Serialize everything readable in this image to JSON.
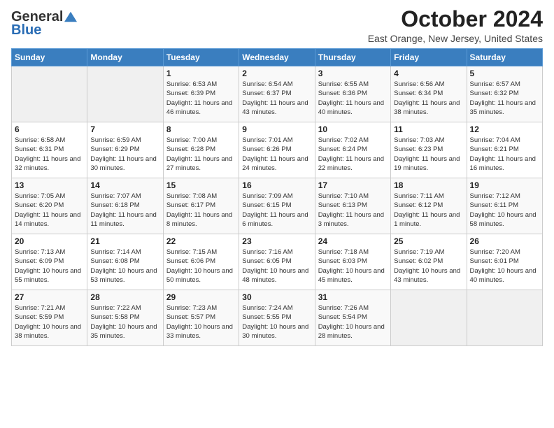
{
  "logo": {
    "general": "General",
    "blue": "Blue"
  },
  "header": {
    "title": "October 2024",
    "location": "East Orange, New Jersey, United States"
  },
  "columns": [
    "Sunday",
    "Monday",
    "Tuesday",
    "Wednesday",
    "Thursday",
    "Friday",
    "Saturday"
  ],
  "weeks": [
    [
      {
        "day": "",
        "info": ""
      },
      {
        "day": "",
        "info": ""
      },
      {
        "day": "1",
        "info": "Sunrise: 6:53 AM\nSunset: 6:39 PM\nDaylight: 11 hours and 46 minutes."
      },
      {
        "day": "2",
        "info": "Sunrise: 6:54 AM\nSunset: 6:37 PM\nDaylight: 11 hours and 43 minutes."
      },
      {
        "day": "3",
        "info": "Sunrise: 6:55 AM\nSunset: 6:36 PM\nDaylight: 11 hours and 40 minutes."
      },
      {
        "day": "4",
        "info": "Sunrise: 6:56 AM\nSunset: 6:34 PM\nDaylight: 11 hours and 38 minutes."
      },
      {
        "day": "5",
        "info": "Sunrise: 6:57 AM\nSunset: 6:32 PM\nDaylight: 11 hours and 35 minutes."
      }
    ],
    [
      {
        "day": "6",
        "info": "Sunrise: 6:58 AM\nSunset: 6:31 PM\nDaylight: 11 hours and 32 minutes."
      },
      {
        "day": "7",
        "info": "Sunrise: 6:59 AM\nSunset: 6:29 PM\nDaylight: 11 hours and 30 minutes."
      },
      {
        "day": "8",
        "info": "Sunrise: 7:00 AM\nSunset: 6:28 PM\nDaylight: 11 hours and 27 minutes."
      },
      {
        "day": "9",
        "info": "Sunrise: 7:01 AM\nSunset: 6:26 PM\nDaylight: 11 hours and 24 minutes."
      },
      {
        "day": "10",
        "info": "Sunrise: 7:02 AM\nSunset: 6:24 PM\nDaylight: 11 hours and 22 minutes."
      },
      {
        "day": "11",
        "info": "Sunrise: 7:03 AM\nSunset: 6:23 PM\nDaylight: 11 hours and 19 minutes."
      },
      {
        "day": "12",
        "info": "Sunrise: 7:04 AM\nSunset: 6:21 PM\nDaylight: 11 hours and 16 minutes."
      }
    ],
    [
      {
        "day": "13",
        "info": "Sunrise: 7:05 AM\nSunset: 6:20 PM\nDaylight: 11 hours and 14 minutes."
      },
      {
        "day": "14",
        "info": "Sunrise: 7:07 AM\nSunset: 6:18 PM\nDaylight: 11 hours and 11 minutes."
      },
      {
        "day": "15",
        "info": "Sunrise: 7:08 AM\nSunset: 6:17 PM\nDaylight: 11 hours and 8 minutes."
      },
      {
        "day": "16",
        "info": "Sunrise: 7:09 AM\nSunset: 6:15 PM\nDaylight: 11 hours and 6 minutes."
      },
      {
        "day": "17",
        "info": "Sunrise: 7:10 AM\nSunset: 6:13 PM\nDaylight: 11 hours and 3 minutes."
      },
      {
        "day": "18",
        "info": "Sunrise: 7:11 AM\nSunset: 6:12 PM\nDaylight: 11 hours and 1 minute."
      },
      {
        "day": "19",
        "info": "Sunrise: 7:12 AM\nSunset: 6:11 PM\nDaylight: 10 hours and 58 minutes."
      }
    ],
    [
      {
        "day": "20",
        "info": "Sunrise: 7:13 AM\nSunset: 6:09 PM\nDaylight: 10 hours and 55 minutes."
      },
      {
        "day": "21",
        "info": "Sunrise: 7:14 AM\nSunset: 6:08 PM\nDaylight: 10 hours and 53 minutes."
      },
      {
        "day": "22",
        "info": "Sunrise: 7:15 AM\nSunset: 6:06 PM\nDaylight: 10 hours and 50 minutes."
      },
      {
        "day": "23",
        "info": "Sunrise: 7:16 AM\nSunset: 6:05 PM\nDaylight: 10 hours and 48 minutes."
      },
      {
        "day": "24",
        "info": "Sunrise: 7:18 AM\nSunset: 6:03 PM\nDaylight: 10 hours and 45 minutes."
      },
      {
        "day": "25",
        "info": "Sunrise: 7:19 AM\nSunset: 6:02 PM\nDaylight: 10 hours and 43 minutes."
      },
      {
        "day": "26",
        "info": "Sunrise: 7:20 AM\nSunset: 6:01 PM\nDaylight: 10 hours and 40 minutes."
      }
    ],
    [
      {
        "day": "27",
        "info": "Sunrise: 7:21 AM\nSunset: 5:59 PM\nDaylight: 10 hours and 38 minutes."
      },
      {
        "day": "28",
        "info": "Sunrise: 7:22 AM\nSunset: 5:58 PM\nDaylight: 10 hours and 35 minutes."
      },
      {
        "day": "29",
        "info": "Sunrise: 7:23 AM\nSunset: 5:57 PM\nDaylight: 10 hours and 33 minutes."
      },
      {
        "day": "30",
        "info": "Sunrise: 7:24 AM\nSunset: 5:55 PM\nDaylight: 10 hours and 30 minutes."
      },
      {
        "day": "31",
        "info": "Sunrise: 7:26 AM\nSunset: 5:54 PM\nDaylight: 10 hours and 28 minutes."
      },
      {
        "day": "",
        "info": ""
      },
      {
        "day": "",
        "info": ""
      }
    ]
  ]
}
